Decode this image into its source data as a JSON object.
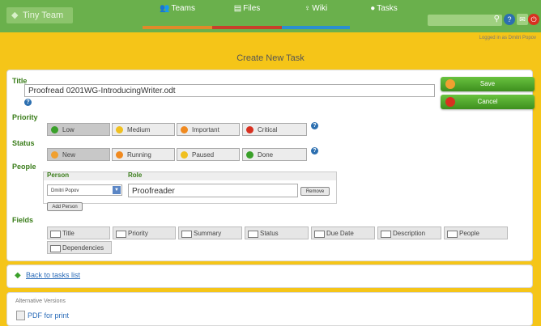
{
  "header": {
    "app_name": "Tiny Team",
    "nav": [
      {
        "label": "Teams",
        "color": "#e08a2a",
        "icon": "people-icon"
      },
      {
        "label": "Files",
        "color": "#c8402a",
        "icon": "files-icon"
      },
      {
        "label": "Wiki",
        "color": "#2a8fd0",
        "icon": "wiki-icon"
      },
      {
        "label": "Tasks",
        "color": "#6ab04c",
        "icon": "tasks-icon"
      }
    ],
    "logged_in": "Logged in as Dmitri Popov"
  },
  "page_title": "Create New Task",
  "form": {
    "title_label": "Title",
    "title_value": "Proofread 0201WG-IntroducingWriter.odt",
    "save_label": "Save",
    "cancel_label": "Cancel",
    "priority_label": "Priority",
    "priority_options": [
      {
        "label": "Low",
        "color": "#3aa02a",
        "selected": true
      },
      {
        "label": "Medium",
        "color": "#f0c020",
        "selected": false
      },
      {
        "label": "Important",
        "color": "#f08a20",
        "selected": false
      },
      {
        "label": "Critical",
        "color": "#d83020",
        "selected": false
      }
    ],
    "status_label": "Status",
    "status_options": [
      {
        "label": "New",
        "color": "#f0a030",
        "selected": true
      },
      {
        "label": "Running",
        "color": "#f08a20",
        "selected": false
      },
      {
        "label": "Paused",
        "color": "#f0c020",
        "selected": false
      },
      {
        "label": "Done",
        "color": "#3aa02a",
        "selected": false
      }
    ],
    "people_label": "People",
    "people_headers": {
      "person": "Person",
      "role": "Role"
    },
    "person_value": "Dmitri Popov",
    "role_value": "Proofreader",
    "remove_label": "Remove",
    "add_person_label": "Add Person",
    "fields_label": "Fields",
    "fields": [
      "Title",
      "Priority",
      "Summary",
      "Status",
      "Due Date",
      "Description",
      "People",
      "Dependencies"
    ]
  },
  "back_link": "Back to tasks list",
  "alt_versions": {
    "heading": "Alternative Versions",
    "pdf_link": "PDF for print"
  }
}
